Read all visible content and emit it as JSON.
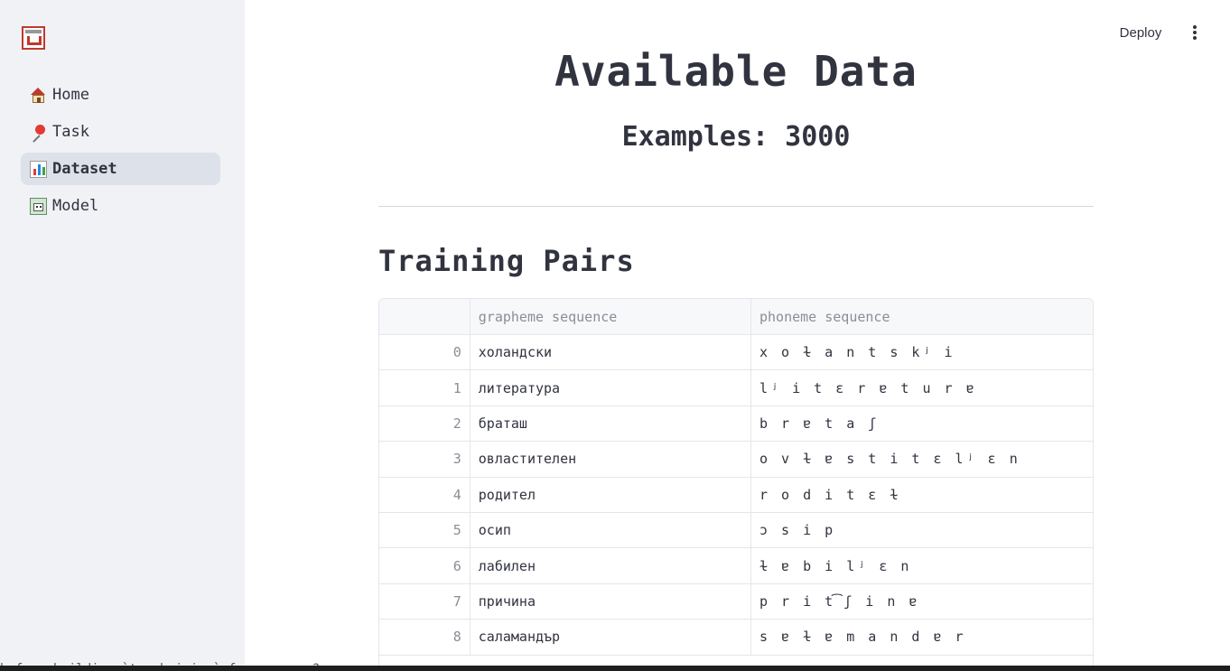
{
  "header": {
    "deploy_label": "Deploy",
    "menu_icon": "vertical-dots-icon"
  },
  "sidebar": {
    "logo_icon": "app-logo-icon",
    "items": [
      {
        "label": "Home",
        "icon": "home-icon",
        "active": false
      },
      {
        "label": "Task",
        "icon": "pushpin-icon",
        "active": false
      },
      {
        "label": "Dataset",
        "icon": "bar-chart-icon",
        "active": true
      },
      {
        "label": "Model",
        "icon": "model-icon",
        "active": false
      }
    ]
  },
  "main": {
    "title": "Available Data",
    "subtitle": "Examples: 3000",
    "section_title": "Training Pairs",
    "table": {
      "columns": [
        "",
        "grapheme sequence",
        "phoneme sequence"
      ],
      "rows": [
        {
          "index": "0",
          "grapheme": "холандски",
          "phoneme": "x o ɫ a n t s kʲ i"
        },
        {
          "index": "1",
          "grapheme": "литература",
          "phoneme": "lʲ i t ɛ r ɐ t u r ɐ"
        },
        {
          "index": "2",
          "grapheme": "браташ",
          "phoneme": "b r ɐ t a ʃ"
        },
        {
          "index": "3",
          "grapheme": "овластителен",
          "phoneme": "o v ɫ ɐ s t i t ɛ lʲ ɛ n"
        },
        {
          "index": "4",
          "grapheme": "родител",
          "phoneme": "r o d i t ɛ ɫ"
        },
        {
          "index": "5",
          "grapheme": "осип",
          "phoneme": "ɔ s i p"
        },
        {
          "index": "6",
          "grapheme": "лабилен",
          "phoneme": "ɫ ɐ b i lʲ ɛ n"
        },
        {
          "index": "7",
          "grapheme": "причина",
          "phoneme": "p r i t͡ʃ i n ɐ"
        },
        {
          "index": "8",
          "grapheme": "саламандър",
          "phoneme": "s ɐ ɫ ɐ m a n d ɐ r"
        }
      ]
    }
  },
  "terminal": {
    "text": "before building `torchvision` from source?"
  }
}
